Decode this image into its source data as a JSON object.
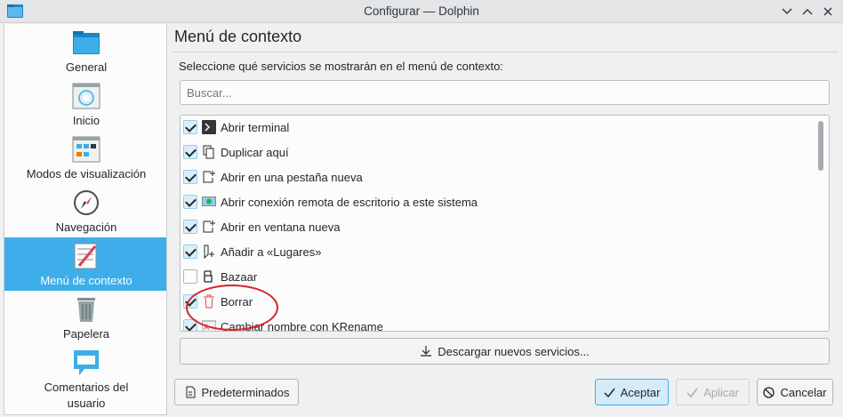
{
  "window": {
    "title": "Configurar — Dolphin",
    "controls": [
      "chevron-down",
      "chevron-up",
      "close"
    ]
  },
  "sidebar": {
    "items": [
      {
        "label": "General",
        "icon": "folder-icon",
        "selected": false
      },
      {
        "label": "Inicio",
        "icon": "home-window-icon",
        "selected": false
      },
      {
        "label": "Modos de visualización",
        "icon": "view-modes-icon",
        "selected": false
      },
      {
        "label": "Navegación",
        "icon": "compass-icon",
        "selected": false
      },
      {
        "label": "Menú de contexto",
        "icon": "context-menu-icon",
        "selected": true
      },
      {
        "label": "Papelera",
        "icon": "trash-icon",
        "selected": false
      },
      {
        "label": "Comentarios del usuario",
        "icon": "feedback-icon",
        "selected": false
      }
    ]
  },
  "main": {
    "page_title": "Menú de contexto",
    "description": "Seleccione qué servicios se mostrarán en el menú de contexto:",
    "search_placeholder": "Buscar...",
    "services": [
      {
        "label": "Abrir terminal",
        "checked": true,
        "icon": "terminal-icon"
      },
      {
        "label": "Duplicar aquí",
        "checked": true,
        "icon": "duplicate-icon"
      },
      {
        "label": "Abrir en una pestaña nueva",
        "checked": true,
        "icon": "new-tab-icon"
      },
      {
        "label": "Abrir conexión remota de escritorio a este sistema",
        "checked": true,
        "icon": "remote-desktop-icon"
      },
      {
        "label": "Abrir en ventana nueva",
        "checked": true,
        "icon": "new-window-icon"
      },
      {
        "label": "Añadir a «Lugares»",
        "checked": true,
        "icon": "bookmark-add-icon"
      },
      {
        "label": "Bazaar",
        "checked": false,
        "icon": "bazaar-icon"
      },
      {
        "label": "Borrar",
        "checked": true,
        "icon": "delete-icon"
      },
      {
        "label": "Cambiar nombre con KRename",
        "checked": true,
        "icon": "krename-icon"
      }
    ],
    "download_button": "Descargar nuevos servicios..."
  },
  "footer": {
    "defaults_button": "Predeterminados",
    "accept_button": "Aceptar",
    "apply_button": "Aplicar",
    "cancel_button": "Cancelar"
  },
  "colors": {
    "accent": "#3daee9",
    "annotation": "#d8232a"
  }
}
